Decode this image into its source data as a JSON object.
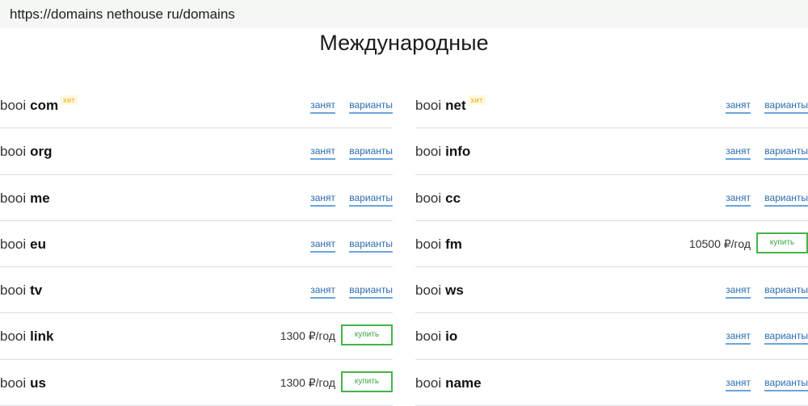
{
  "browser": {
    "url": "https://domains nethouse ru/domains"
  },
  "page": {
    "title": "Международные"
  },
  "labels": {
    "hit": "хит",
    "taken": "занят",
    "variants": "варианты",
    "buy": "купить"
  },
  "left_column": [
    {
      "prefix": "booi",
      "tld": "com",
      "hit": true,
      "state": "taken"
    },
    {
      "prefix": "booi",
      "tld": "org",
      "hit": false,
      "state": "taken"
    },
    {
      "prefix": "booi",
      "tld": "me",
      "hit": false,
      "state": "taken"
    },
    {
      "prefix": "booi",
      "tld": "eu",
      "hit": false,
      "state": "taken"
    },
    {
      "prefix": "booi",
      "tld": "tv",
      "hit": false,
      "state": "taken"
    },
    {
      "prefix": "booi",
      "tld": "link",
      "hit": false,
      "state": "available",
      "price": "1300 ₽/год"
    },
    {
      "prefix": "booi",
      "tld": "us",
      "hit": false,
      "state": "available",
      "price": "1300 ₽/год"
    }
  ],
  "right_column": [
    {
      "prefix": "booi",
      "tld": "net",
      "hit": true,
      "state": "taken"
    },
    {
      "prefix": "booi",
      "tld": "info",
      "hit": false,
      "state": "taken"
    },
    {
      "prefix": "booi",
      "tld": "cc",
      "hit": false,
      "state": "taken"
    },
    {
      "prefix": "booi",
      "tld": "fm",
      "hit": false,
      "state": "available",
      "price": "10500 ₽/год"
    },
    {
      "prefix": "booi",
      "tld": "ws",
      "hit": false,
      "state": "taken"
    },
    {
      "prefix": "booi",
      "tld": "io",
      "hit": false,
      "state": "taken"
    },
    {
      "prefix": "booi",
      "tld": "name",
      "hit": false,
      "state": "taken"
    }
  ]
}
